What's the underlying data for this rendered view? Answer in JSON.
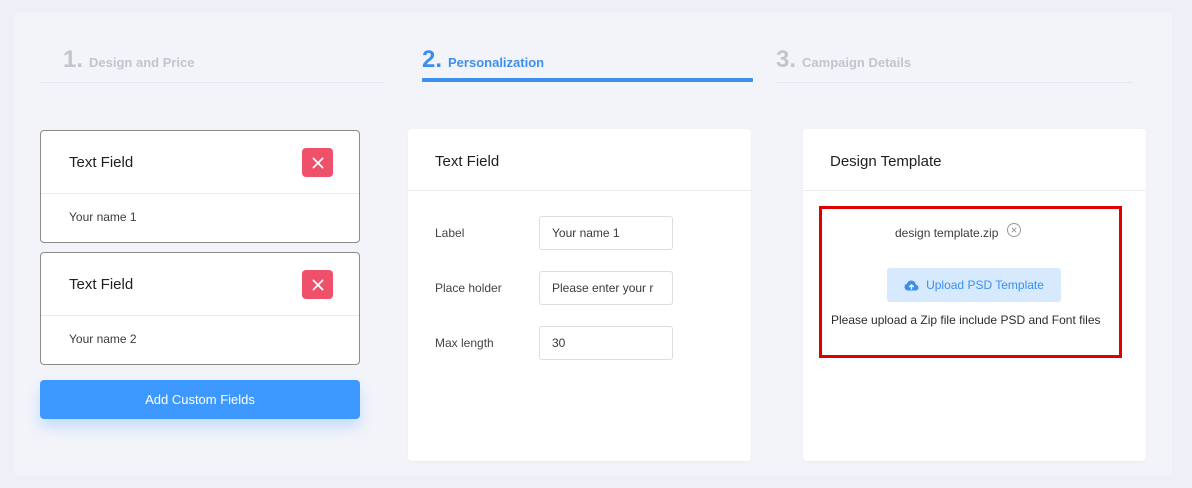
{
  "steps": [
    {
      "number": "1.",
      "label": "Design and Price",
      "state": "inactive"
    },
    {
      "number": "2.",
      "label": "Personalization",
      "state": "active"
    },
    {
      "number": "3.",
      "label": "Campaign Details",
      "state": "inactive"
    }
  ],
  "custom_fields": [
    {
      "title": "Text Field",
      "value": "Your name 1"
    },
    {
      "title": "Text Field",
      "value": "Your name 2"
    }
  ],
  "add_button_label": "Add Custom Fields",
  "field_editor": {
    "title": "Text Field",
    "label_caption": "Label",
    "label_value": "Your name 1",
    "placeholder_caption": "Place holder",
    "placeholder_value": "Please enter your r",
    "maxlength_caption": "Max length",
    "maxlength_value": "30"
  },
  "design_template": {
    "title": "Design Template",
    "file_name": "design template.zip",
    "upload_button_label": "Upload PSD Template",
    "hint": "Please upload a Zip file include PSD and Font files"
  },
  "icons": {
    "delete": "close-icon",
    "remove_file": "circle-close-icon",
    "upload": "cloud-upload-icon"
  },
  "colors": {
    "accent": "#3d8fee",
    "button": "#3d99ff",
    "delete": "#f0516a",
    "highlight_border": "#e00000"
  }
}
